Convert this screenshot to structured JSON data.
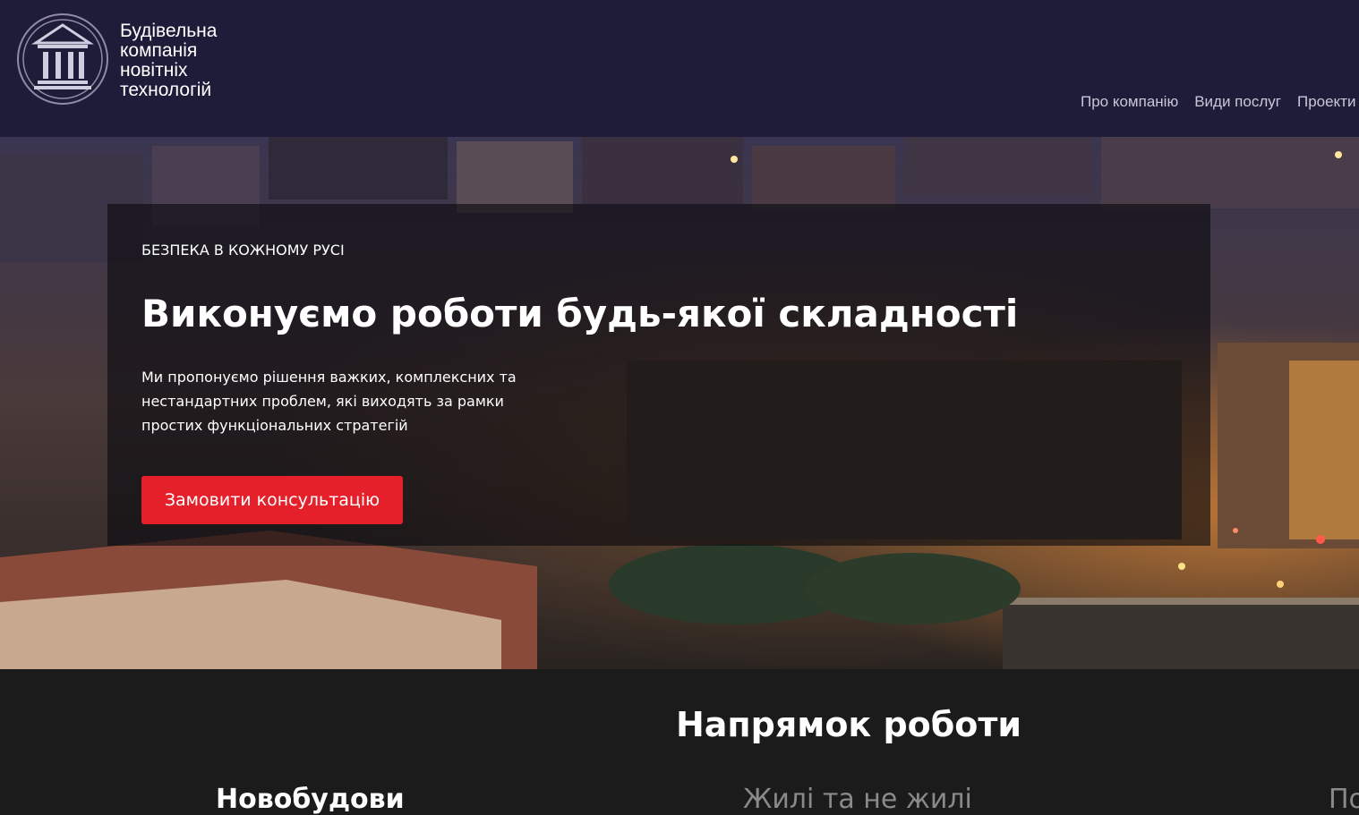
{
  "header": {
    "brand_lines": [
      "Будівельна",
      "компанія",
      "новітніх",
      "технологій"
    ],
    "logo_icon": "columns-building-icon",
    "nav": [
      {
        "label": "Про компанію"
      },
      {
        "label": "Види послуг"
      },
      {
        "label": "Проекти"
      }
    ]
  },
  "hero": {
    "eyebrow": "БЕЗПЕКА В КОЖНОМУ РУСІ",
    "title": "Виконуємо роботи будь-якої складності",
    "text": "Ми пропонуємо рішення важких, комплексних та нестандартних проблем, які виходять за рамки простих функціональних стратегій",
    "cta_label": "Замовити консультацію",
    "cta_color": "#e5202a"
  },
  "directions": {
    "title": "Напрямок роботи",
    "tabs": [
      {
        "label": "Новобудови",
        "active": true
      },
      {
        "label": "Жилі та не жилі",
        "active": false
      },
      {
        "label": "По",
        "active": false
      }
    ]
  },
  "colors": {
    "header_bg": "#1f1c3a",
    "section_bg": "#1b1b1b",
    "accent": "#e5202a"
  }
}
